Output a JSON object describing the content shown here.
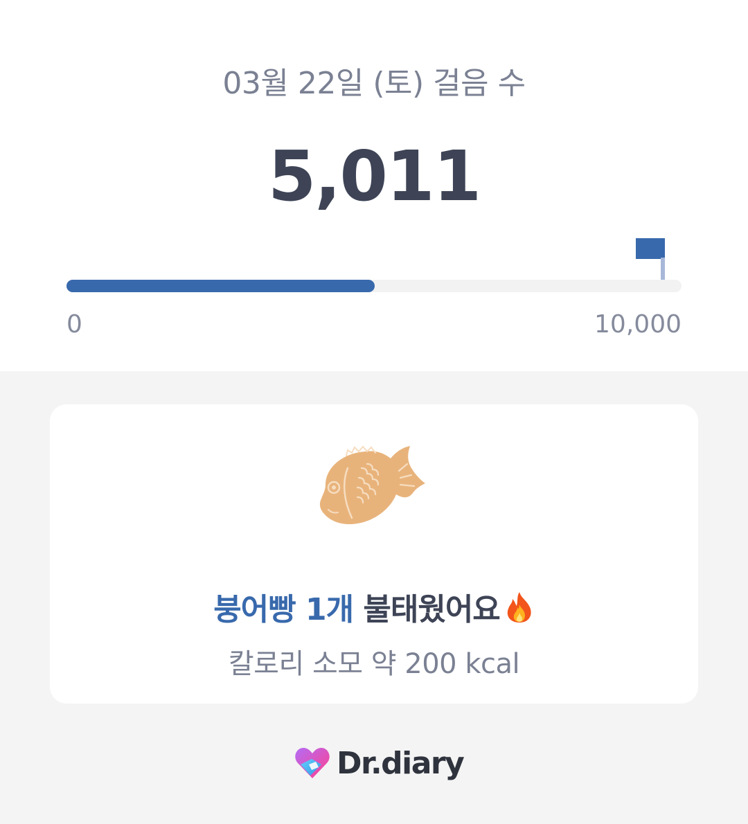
{
  "header": {
    "date_title": "03월 22일 (토) 걸음 수",
    "step_count": "5,011"
  },
  "progress": {
    "value": 5011,
    "goal": 10000,
    "fraction": 0.5011,
    "min_label": "0",
    "max_label": "10,000",
    "goal_icon": "flag-icon",
    "color": "#3869ac"
  },
  "card": {
    "illustration": "bungeoppang-icon",
    "headline_highlight": "붕어빵 1개",
    "headline_rest": " 불태웠어요",
    "headline_icon": "fire-icon",
    "calorie_text": "칼로리 소모 약 200 kcal"
  },
  "brand": {
    "logo_icon": "heart-logo-icon",
    "name": "Dr.diary"
  },
  "colors": {
    "accent": "#3869ac",
    "text_dark": "#3e4456",
    "text_muted": "#7b8193",
    "background": "#f4f4f4"
  }
}
